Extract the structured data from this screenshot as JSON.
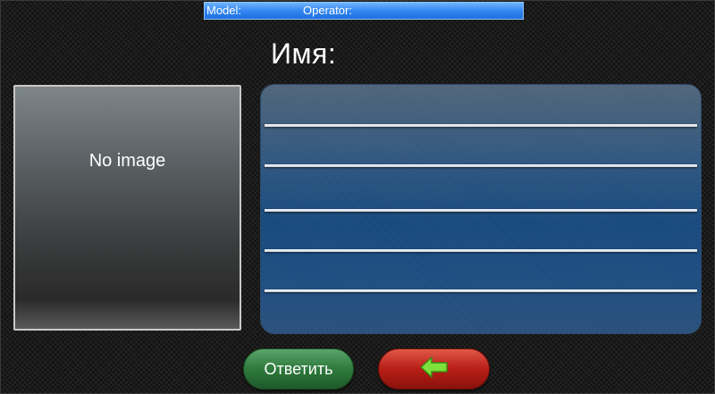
{
  "status_bar": {
    "model_label": "Model:",
    "operator_label": "Operator:"
  },
  "title": "Имя:",
  "image_panel": {
    "placeholder": "No image"
  },
  "list": {
    "rows": [
      "",
      "",
      "",
      "",
      ""
    ]
  },
  "buttons": {
    "answer_label": "Ответить",
    "back_icon": "arrow-left-icon"
  },
  "colors": {
    "accent_blue": "#2f84ef",
    "list_blue": "#16487c",
    "answer_green": "#2e7a3c",
    "back_red": "#b81e16",
    "arrow_green": "#7ee03a"
  }
}
